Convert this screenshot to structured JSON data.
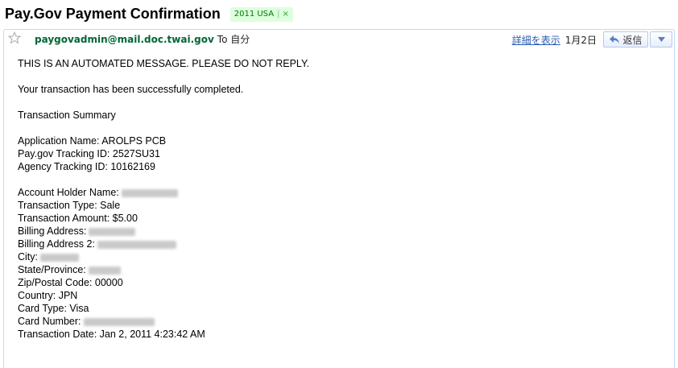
{
  "subject": {
    "title": "Pay.Gov Payment Confirmation",
    "label": "2011 USA",
    "label_separator": "|",
    "label_remove": "×"
  },
  "header": {
    "sender": "paygovadmin@mail.doc.twai.gov",
    "to_text": "To 自分",
    "details_link": "詳細を表示",
    "date": "1月2日",
    "reply_label": "返信"
  },
  "body": {
    "notice": "THIS IS AN AUTOMATED MESSAGE.  PLEASE DO NOT REPLY.",
    "completed": "Your transaction has been successfully completed.",
    "summary_heading": "Transaction Summary",
    "application_name": "Application Name: AROLPS PCB",
    "tracking_id": "Pay.gov Tracking ID: 2527SU31",
    "agency_tracking_id": "Agency Tracking ID: 10162169",
    "account_holder_label": "Account Holder Name:",
    "transaction_type": "Transaction Type: Sale",
    "transaction_amount": "Transaction Amount: $5.00",
    "billing_address_label": "Billing Address:",
    "billing_address2_label": "Billing Address 2:",
    "city_label": "City:",
    "state_label": "State/Province:",
    "zip": "Zip/Postal Code: 00000",
    "country": "Country: JPN",
    "card_type": "Card Type: Visa",
    "card_number_label": "Card Number:",
    "transaction_date": "Transaction Date: Jan 2, 2011 4:23:42 AM"
  },
  "colors": {
    "sender": "#006633",
    "link": "#2a5db0",
    "label_bg": "#ddffdd",
    "label_text": "#007700",
    "card_border": "#c3d9ff"
  },
  "icons": {
    "star": "star-icon",
    "reply": "reply-arrow-icon",
    "more": "triangle-down-icon"
  }
}
